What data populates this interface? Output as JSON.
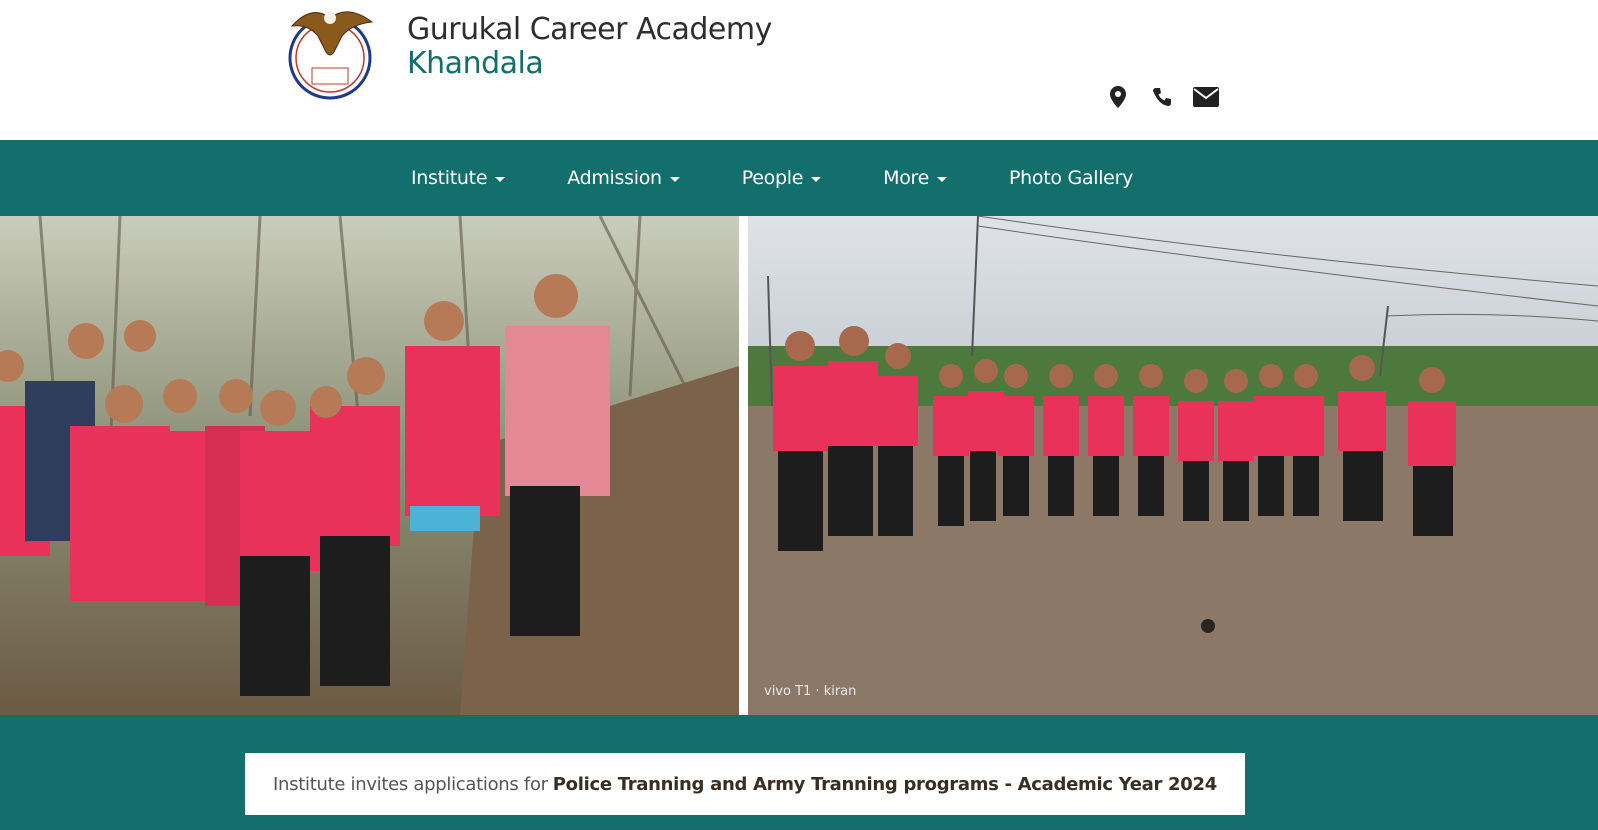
{
  "header": {
    "title_line1": "Gurukal Career Academy",
    "title_line2": "Khandala",
    "logo_text": "विश्वास कष्ट यश",
    "contact_icons": [
      "map-marker-icon",
      "phone-icon",
      "envelope-icon"
    ]
  },
  "nav": {
    "items": [
      {
        "label": "Institute",
        "dropdown": true
      },
      {
        "label": "Admission",
        "dropdown": true
      },
      {
        "label": "People",
        "dropdown": true
      },
      {
        "label": "More",
        "dropdown": true
      },
      {
        "label": "Photo Gallery",
        "dropdown": false
      }
    ]
  },
  "photos": {
    "right_watermark": "vivo T1 · kiran"
  },
  "announcement": {
    "prefix": "Institute invites applications for",
    "highlight": "Police Tranning and Army Tranning programs - Academic Year 2024"
  },
  "colors": {
    "brand_teal": "#126f6b",
    "jersey_pink": "#e8325a"
  }
}
